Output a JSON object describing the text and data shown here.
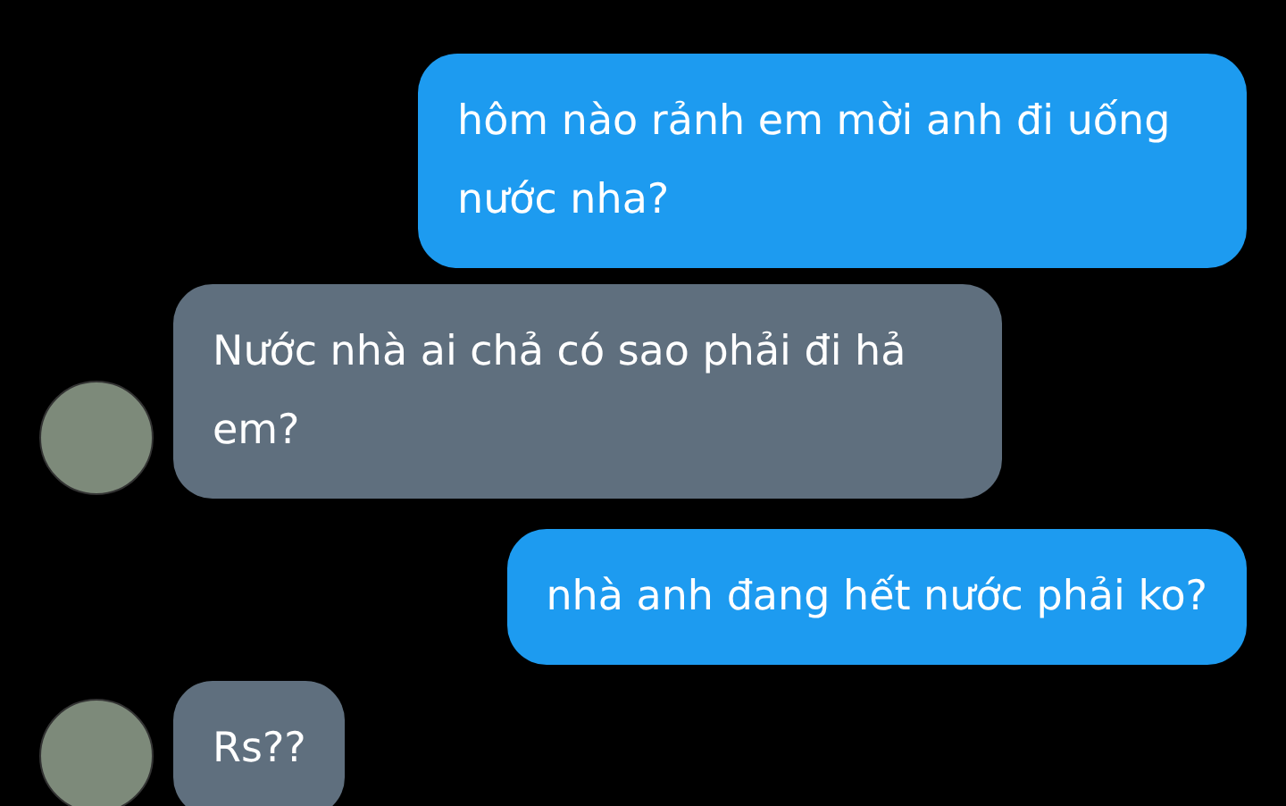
{
  "messages": [
    {
      "kind": "sent",
      "text": "hôm nào rảnh em mời anh đi uống nước nha?"
    },
    {
      "kind": "received",
      "text": "Nước nhà ai chả có sao phải đi hả em?"
    },
    {
      "kind": "sent",
      "text": "nhà anh đang hết nước phải ko?"
    },
    {
      "kind": "received",
      "text": "Rs??"
    }
  ]
}
